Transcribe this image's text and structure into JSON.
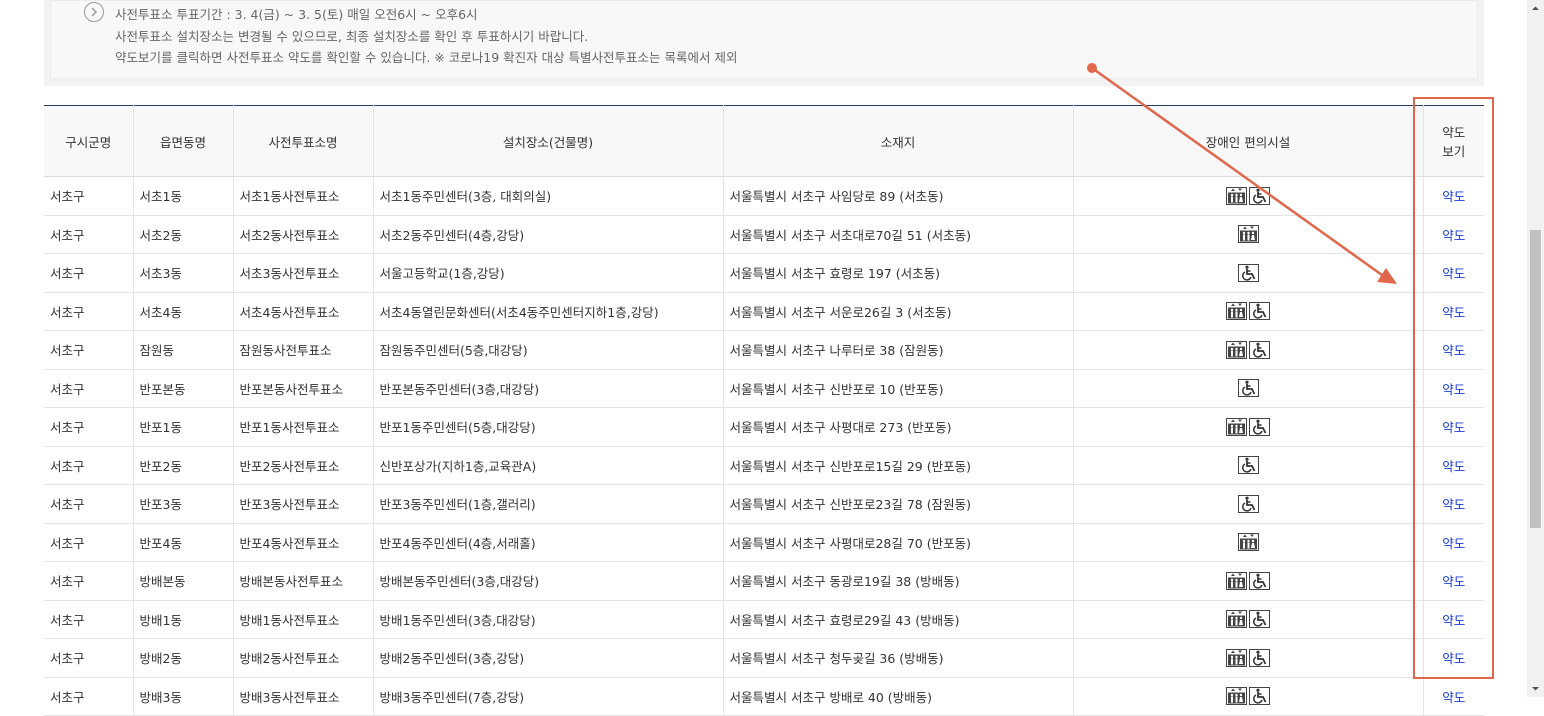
{
  "notice": {
    "line1": "사전투표소 투표기간 : 3. 4(금) ~ 3. 5(토) 매일 오전6시 ~ 오후6시",
    "line2": "사전투표소 설치장소는 변경될 수 있으므로, 최종 설치장소를 확인 후 투표하시기 바랍니다.",
    "line3": "약도보기를 클릭하면 사전투표소 약도를 확인할 수 있습니다. ※ 코로나19 확진자 대상 특별사전투표소는 목록에서 제외"
  },
  "table": {
    "headers": {
      "district": "구시군명",
      "dong": "읍면동명",
      "station": "사전투표소명",
      "location": "설치장소(건물명)",
      "address": "소재지",
      "facilities": "장애인 편의시설",
      "map_line1": "약도",
      "map_line2": "보기"
    },
    "link_label": "약도",
    "rows": [
      {
        "district": "서초구",
        "dong": "서초1동",
        "station": "서초1동사전투표소",
        "location": "서초1동주민센터(3층, 대회의실)",
        "address": "서울특별시 서초구 사임당로 89 (서초동)",
        "facilities": [
          "elevator-icon",
          "wheelchair-icon"
        ]
      },
      {
        "district": "서초구",
        "dong": "서초2동",
        "station": "서초2동사전투표소",
        "location": "서초2동주민센터(4층,강당)",
        "address": "서울특별시 서초구 서초대로70길 51 (서초동)",
        "facilities": [
          "elevator-icon"
        ]
      },
      {
        "district": "서초구",
        "dong": "서초3동",
        "station": "서초3동사전투표소",
        "location": "서울고등학교(1층,강당)",
        "address": "서울특별시 서초구 효령로 197 (서초동)",
        "facilities": [
          "wheelchair-icon"
        ]
      },
      {
        "district": "서초구",
        "dong": "서초4동",
        "station": "서초4동사전투표소",
        "location": "서초4동열린문화센터(서초4동주민센터지하1층,강당)",
        "address": "서울특별시 서초구 서운로26길 3 (서초동)",
        "facilities": [
          "elevator-icon",
          "wheelchair-icon"
        ]
      },
      {
        "district": "서초구",
        "dong": "잠원동",
        "station": "잠원동사전투표소",
        "location": "잠원동주민센터(5층,대강당)",
        "address": "서울특별시 서초구 나루터로 38 (잠원동)",
        "facilities": [
          "elevator-icon",
          "wheelchair-icon"
        ]
      },
      {
        "district": "서초구",
        "dong": "반포본동",
        "station": "반포본동사전투표소",
        "location": "반포본동주민센터(3층,대강당)",
        "address": "서울특별시 서초구 신반포로 10 (반포동)",
        "facilities": [
          "wheelchair-icon"
        ]
      },
      {
        "district": "서초구",
        "dong": "반포1동",
        "station": "반포1동사전투표소",
        "location": "반포1동주민센터(5층,대강당)",
        "address": "서울특별시 서초구 사평대로 273 (반포동)",
        "facilities": [
          "elevator-icon",
          "wheelchair-icon"
        ]
      },
      {
        "district": "서초구",
        "dong": "반포2동",
        "station": "반포2동사전투표소",
        "location": "신반포상가(지하1층,교육관A)",
        "address": "서울특별시 서초구 신반포로15길 29 (반포동)",
        "facilities": [
          "wheelchair-icon"
        ]
      },
      {
        "district": "서초구",
        "dong": "반포3동",
        "station": "반포3동사전투표소",
        "location": "반포3동주민센터(1층,갤러리)",
        "address": "서울특별시 서초구 신반포로23길 78 (잠원동)",
        "facilities": [
          "wheelchair-icon"
        ]
      },
      {
        "district": "서초구",
        "dong": "반포4동",
        "station": "반포4동사전투표소",
        "location": "반포4동주민센터(4층,서래홀)",
        "address": "서울특별시 서초구 사평대로28길 70 (반포동)",
        "facilities": [
          "elevator-icon"
        ]
      },
      {
        "district": "서초구",
        "dong": "방배본동",
        "station": "방배본동사전투표소",
        "location": "방배본동주민센터(3층,대강당)",
        "address": "서울특별시 서초구 동광로19길 38 (방배동)",
        "facilities": [
          "elevator-icon",
          "wheelchair-icon"
        ]
      },
      {
        "district": "서초구",
        "dong": "방배1동",
        "station": "방배1동사전투표소",
        "location": "방배1동주민센터(3층,대강당)",
        "address": "서울특별시 서초구 효령로29길 43 (방배동)",
        "facilities": [
          "elevator-icon",
          "wheelchair-icon"
        ]
      },
      {
        "district": "서초구",
        "dong": "방배2동",
        "station": "방배2동사전투표소",
        "location": "방배2동주민센터(3층,강당)",
        "address": "서울특별시 서초구 청두곶길 36 (방배동)",
        "facilities": [
          "elevator-icon",
          "wheelchair-icon"
        ]
      },
      {
        "district": "서초구",
        "dong": "방배3동",
        "station": "방배3동사전투표소",
        "location": "방배3동주민센터(7층,강당)",
        "address": "서울특별시 서초구 방배로 40 (방배동)",
        "facilities": [
          "elevator-icon",
          "wheelchair-icon"
        ]
      }
    ]
  },
  "colors": {
    "annotation": "#e0674b",
    "link": "#1a3bd6",
    "header_top_border": "#2c3e66"
  }
}
